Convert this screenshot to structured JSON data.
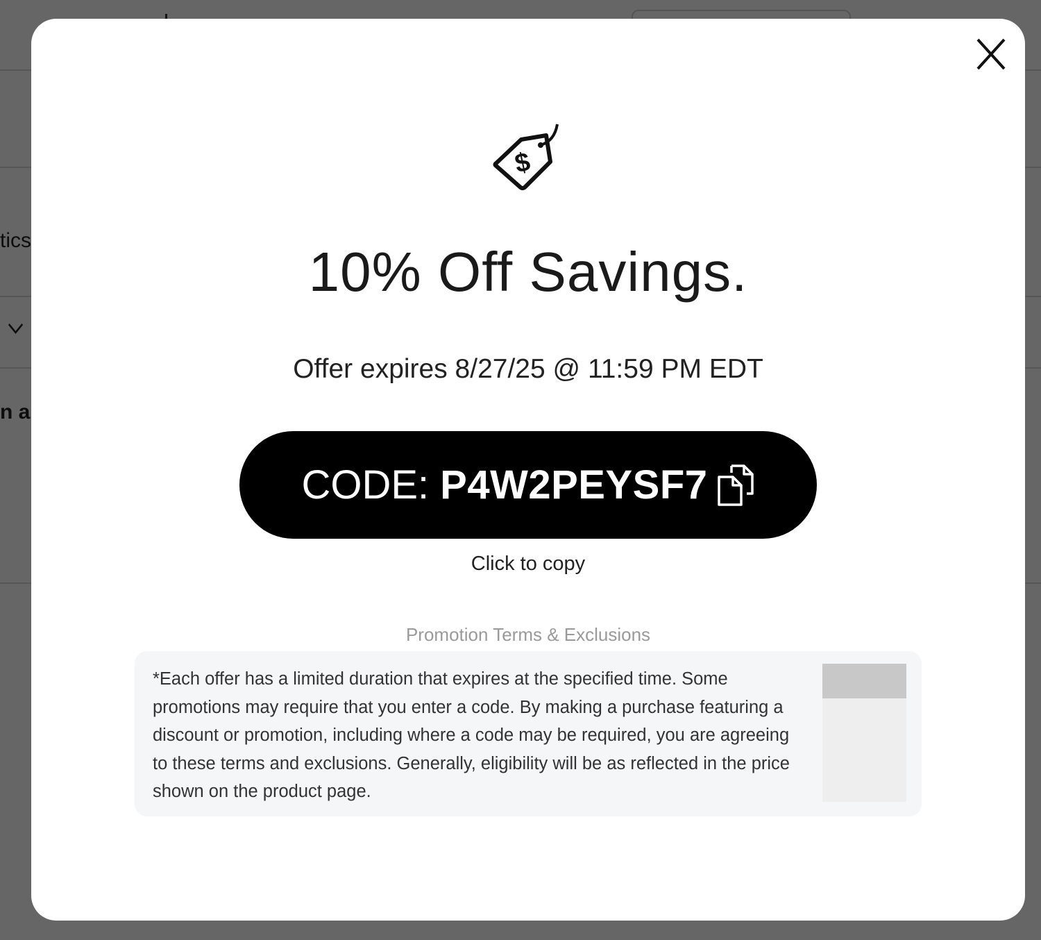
{
  "background": {
    "partial_text_1": "tics",
    "partial_text_2": "n a",
    "chevron_icon": "chevron-down-icon"
  },
  "modal": {
    "close_icon": "close-icon",
    "tag_icon": "price-tag-dollar-icon",
    "title": "10% Off Savings.",
    "expires_text": "Offer expires 8/27/25 @ 11:59 PM EDT",
    "code_prefix": "CODE:",
    "code_value": "P4W2PEYSF7",
    "copy_icon": "copy-icon",
    "copy_hint": "Click to copy",
    "terms_heading": "Promotion Terms & Exclusions",
    "terms_text": "*Each offer has a limited duration that expires at the specified time. Some promotions may require that you enter a code. By making a purchase featuring a discount or promotion, including where a code may be required, you are agreeing to these terms and exclusions. Generally, eligibility will be as reflected in the price shown on the product page."
  },
  "colors": {
    "overlay": "#000000",
    "code_button_bg": "#000000",
    "code_button_text": "#ffffff",
    "terms_bg": "#f4f6f8",
    "terms_heading": "#9a9a9a"
  }
}
